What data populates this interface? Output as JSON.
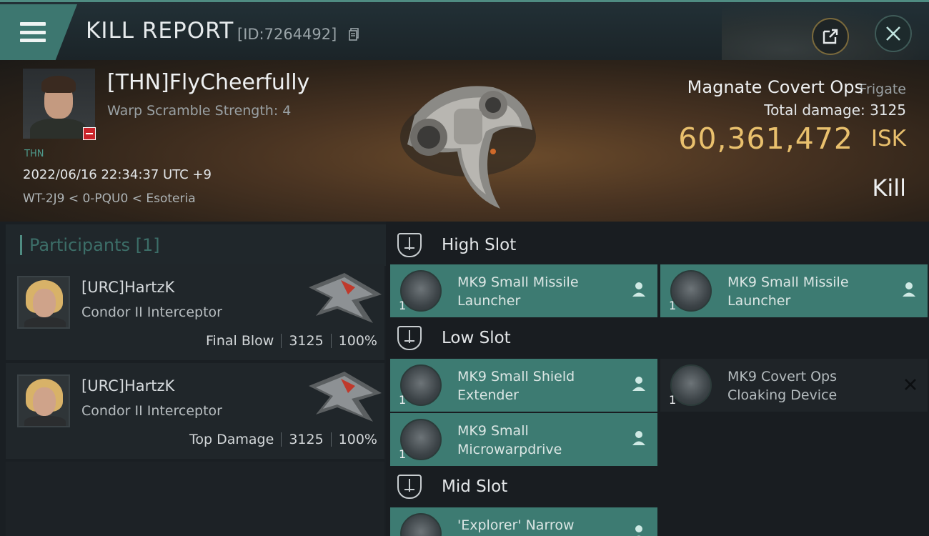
{
  "header": {
    "title": "KILL REPORT",
    "report_id": "[ID:7264492]",
    "icons": [
      "menu-icon",
      "copy-icon",
      "external-link-icon",
      "close-icon"
    ]
  },
  "victim": {
    "name": "[THN]FlyCheerfully",
    "warp_scramble": "Warp Scramble Strength: 4",
    "corp_tag": "THN",
    "datetime": "2022/06/16 22:34:37 UTC +9",
    "location": "WT-2J9 < 0-PQU0 < Esoteria",
    "ship_name": "Magnate Covert Ops",
    "ship_class": "Frigate",
    "total_damage": "Total damage:  3125",
    "isk_value": "60,361,472",
    "isk_unit": "ISK",
    "result": "Kill"
  },
  "participants": {
    "title": "Participants [1]",
    "items": [
      {
        "name": "[URC]HartzK",
        "ship": "Condor II Interceptor",
        "role": "Final Blow",
        "damage": "3125",
        "percent": "100%"
      },
      {
        "name": "[URC]HartzK",
        "ship": "Condor II Interceptor",
        "role": "Top Damage",
        "damage": "3125",
        "percent": "100%"
      }
    ]
  },
  "fitting": {
    "high_slot": {
      "label": "High Slot",
      "modules": [
        {
          "name": "MK9 Small Missile Launcher",
          "qty": "1",
          "status": "dropped"
        },
        {
          "name": "MK9 Small Missile Launcher",
          "qty": "1",
          "status": "dropped"
        }
      ]
    },
    "low_slot": {
      "label": "Low Slot",
      "modules": [
        {
          "name": "MK9 Small Shield Extender",
          "qty": "1",
          "status": "dropped"
        },
        {
          "name": "MK9 Covert Ops Cloaking Device",
          "qty": "1",
          "status": "destroyed"
        },
        {
          "name": "MK9 Small Microwarpdrive",
          "qty": "1",
          "status": "dropped"
        }
      ]
    },
    "mid_slot": {
      "label": "Mid Slot",
      "modules": [
        {
          "name": "'Explorer' Narrow",
          "qty": "1",
          "status": "dropped"
        }
      ]
    }
  },
  "colors": {
    "accent": "#3d7b72",
    "isk_gold": "#e9c06d",
    "destroyed_bg": "#1f2428"
  }
}
